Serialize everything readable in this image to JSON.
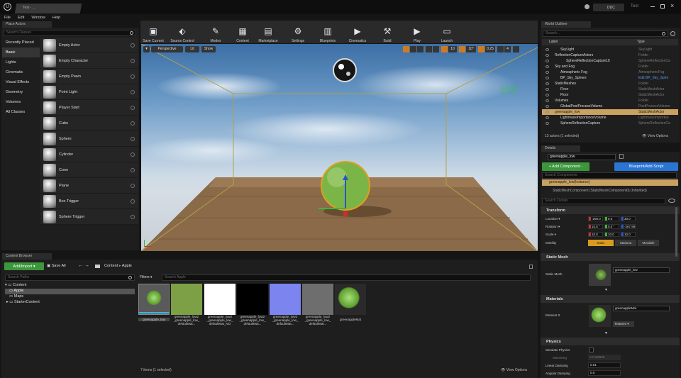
{
  "window": {
    "title": "Test",
    "tab_title": "Test - ...",
    "ddc": "DDC",
    "menu": [
      "File",
      "Edit",
      "Window",
      "Help"
    ]
  },
  "place_actors": {
    "tab": "Place Actors",
    "search_placeholder": "Search Classes",
    "categories": [
      "Recently Placed",
      "Basic",
      "Lights",
      "Cinematic",
      "Visual Effects",
      "Geometry",
      "Volumes",
      "All Classes"
    ],
    "items": [
      "Empty Actor",
      "Empty Character",
      "Empty Pawn",
      "Point Light",
      "Player Start",
      "Cube",
      "Sphere",
      "Cylinder",
      "Cone",
      "Plane",
      "Box Trigger",
      "Sphere Trigger"
    ]
  },
  "toolbar": {
    "items": [
      {
        "label": "Save Current",
        "icon": "save-icon"
      },
      {
        "label": "Source Control",
        "icon": "source-control-icon"
      },
      {
        "label": "Modes",
        "icon": "modes-icon"
      },
      {
        "label": "Content",
        "icon": "content-icon"
      },
      {
        "label": "Marketplace",
        "icon": "marketplace-icon"
      },
      {
        "label": "Settings",
        "icon": "settings-icon"
      },
      {
        "label": "Blueprints",
        "icon": "blueprints-icon"
      },
      {
        "label": "Cinematics",
        "icon": "cinematics-icon"
      },
      {
        "label": "Build",
        "icon": "build-icon"
      },
      {
        "label": "Play",
        "icon": "play-icon"
      },
      {
        "label": "Launch",
        "icon": "launch-icon"
      }
    ]
  },
  "viewport": {
    "perspective": "Perspective",
    "lit": "Lit",
    "show": "Show",
    "fps": "60.00 FPS",
    "ms": "16.57 ms",
    "grid": "10",
    "angle": "10°",
    "scale": "0.25",
    "cam": "4"
  },
  "outliner": {
    "tab": "World Outliner",
    "search_placeholder": "Search...",
    "col_label": "Label",
    "col_type": "Type",
    "rows": [
      {
        "label": "SkyLight",
        "type": "SkyLight",
        "indent": 1
      },
      {
        "label": "ReflectionCaptureActors",
        "type": "Folder",
        "indent": 0
      },
      {
        "label": "SphereReflectionCapture10",
        "type": "SphereReflectionCa",
        "indent": 2
      },
      {
        "label": "Sky and Fog",
        "type": "Folder",
        "indent": 0
      },
      {
        "label": "Atmospheric Fog",
        "type": "AtmosphericFog",
        "indent": 1
      },
      {
        "label": "BP_Sky_Sphere",
        "type": "Edit BP_Sky_Sphe",
        "indent": 1
      },
      {
        "label": "StaticMeshes",
        "type": "Folder",
        "indent": 0
      },
      {
        "label": "Floor",
        "type": "StaticMeshActor",
        "indent": 1
      },
      {
        "label": "Floor",
        "type": "StaticMeshActor",
        "indent": 1
      },
      {
        "label": "Volumes",
        "type": "Folder",
        "indent": 0
      },
      {
        "label": "GlobalPostProcessVolume",
        "type": "PostProcessVolume",
        "indent": 1
      },
      {
        "label": "greenapple_low",
        "type": "StaticMeshActor",
        "indent": 0,
        "selected": true
      },
      {
        "label": "LightmassImportanceVolume",
        "type": "LightmassImportan",
        "indent": 1
      },
      {
        "label": "SphereReflectionCapture",
        "type": "SphereReflectionCa",
        "indent": 1
      }
    ],
    "status": "13 actors (1 selected)",
    "view_options": "View Options"
  },
  "details": {
    "tab": "Details",
    "name": "greenapple_low",
    "add_component": "+ Add Component -",
    "blueprint": "Blueprint/Add Script",
    "search_components": "Search Components",
    "instance": "greenapple_low(Instance)",
    "component": "StaticMeshComponent (StaticMeshComponent0) (Inherited)",
    "search_details": "Search Details",
    "transform": "Transform",
    "location_label": "Location ▾",
    "location": [
      "-200.0",
      "0.0",
      "30.0"
    ],
    "rotation_label": "Rotation ▾",
    "rotation": [
      "10.0 °",
      "0.0 °",
      "-267.99"
    ],
    "scale_label": "Scale ▾",
    "scale": [
      "10.0",
      "10.0",
      "10.0"
    ],
    "mobility_label": "Mobility",
    "mobility": [
      "Static",
      "Stationa",
      "Movable"
    ],
    "static_mesh_section": "Static Mesh",
    "static_mesh_label": "Static Mesh",
    "static_mesh_value": "greenapple_low",
    "materials_section": "Materials",
    "element_label": "Element 0",
    "material_value": "greenappleMat",
    "textures": "Textures ▾",
    "physics_section": "Physics",
    "simulate": "Simulate Physics",
    "mass": "MassInKg",
    "mass_value": "14.948655",
    "linear_damping": "Linear Damping",
    "linear_value": "0.01",
    "angular_damping": "Angular Damping",
    "angular_value": "0.0"
  },
  "content_browser": {
    "tab": "Content Browser",
    "add_import": "Add/Import ▾",
    "save_all": "Save All",
    "path": [
      "Content",
      "Apple"
    ],
    "search_paths": "Search Paths",
    "tree": [
      "Content",
      "Apple",
      "Maps",
      "StarterContent"
    ],
    "filters": "Filters ▾",
    "search_assets": "Search Apple",
    "assets": [
      {
        "label": "greenapple_low",
        "color": "#5a7a3a"
      },
      {
        "label": "greenapple_low2\n_greenapple_low_\ndefaultMat...",
        "color": "#7da046"
      },
      {
        "label": "greenapple_low2\n_greenapple_low_\ndefaultMat_NO",
        "color": "#ffffff"
      },
      {
        "label": "greenapple_low2\n_greenapple_low_\ndefaultMat...",
        "color": "#000000"
      },
      {
        "label": "greenapple_low2\n_greenapple_low_\ndefaultMat...",
        "color": "#7c84f0"
      },
      {
        "label": "greenapple_low2\n_greenapple_low_\ndefaultMat...",
        "color": "#6e6e6e"
      },
      {
        "label": "greenappleMat",
        "color": "#6bae3e"
      }
    ],
    "count": "7 items (1 selected)",
    "view_options": "View Options"
  }
}
